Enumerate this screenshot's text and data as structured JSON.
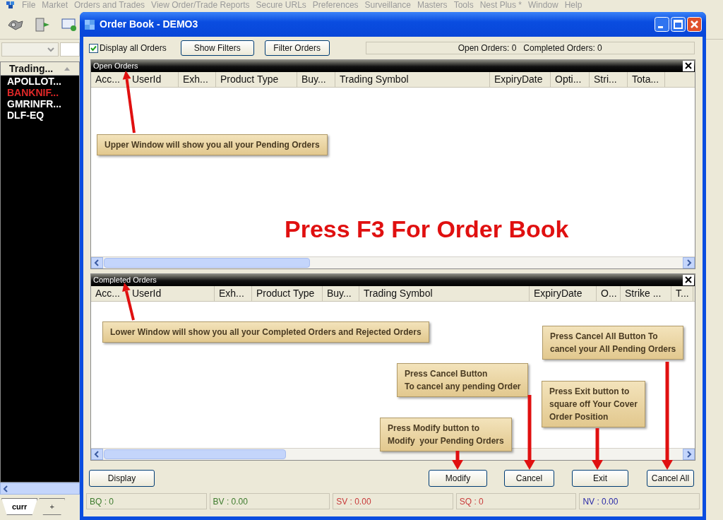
{
  "menu_bar": [
    "File",
    "Market",
    "Orders and Trades",
    "View Order/Trade Reports",
    "Secure URLs",
    "Preferences",
    "Surveillance",
    "Masters",
    "Tools",
    "Nest Plus *",
    "Window",
    "Help"
  ],
  "watch_list": {
    "header": "Trading...",
    "items": [
      {
        "symbol": "APOLLOT...",
        "color": "#ffffff"
      },
      {
        "symbol": "BANKNIF...",
        "color": "#e02828"
      },
      {
        "symbol": "GMRINFR...",
        "color": "#ffffff"
      },
      {
        "symbol": "DLF-EQ",
        "color": "#ffffff"
      }
    ]
  },
  "sheet_tabs": [
    {
      "label": "curr",
      "selected": true
    },
    {
      "label": "+",
      "selected": false
    }
  ],
  "window": {
    "title": "Order Book - DEMO3",
    "display_all_orders": {
      "label": "Display all Orders",
      "checked": true
    },
    "filter_buttons": [
      "Show Filters",
      "Filter Orders"
    ],
    "summary": "Open Orders: 0   Completed Orders: 0",
    "panels": [
      {
        "title": "Open Orders",
        "columns": [
          "Acc...",
          "UserId",
          "Exh...",
          "Product Type",
          "Buy...",
          "Trading Symbol",
          "ExpiryDate",
          "Opti...",
          "Stri...",
          "Tota..."
        ]
      },
      {
        "title": "Completed Orders",
        "columns": [
          "Acc...",
          "UserId",
          "Exh...",
          "Product Type",
          "Buy...",
          "Trading Symbol",
          "ExpiryDate",
          "O...",
          "Strike ...",
          "T..."
        ]
      }
    ],
    "action_buttons": [
      "Display",
      "Modify",
      "Cancel",
      "Exit",
      "Cancel All"
    ],
    "status_bar": [
      {
        "text": "BQ : 0",
        "color": "#3c7a2c"
      },
      {
        "text": "BV : 0.00",
        "color": "#3c7a2c"
      },
      {
        "text": "SV : 0.00",
        "color": "#c83a3a"
      },
      {
        "text": "SQ : 0",
        "color": "#c83a3a"
      },
      {
        "text": "NV : 0.00",
        "color": "#2a2aa8"
      }
    ]
  },
  "annotations": {
    "headline": "Press F3 For Order Book",
    "callouts": [
      {
        "lines": [
          "Upper Window will show you all your Pending Orders"
        ]
      },
      {
        "lines": [
          "Lower Window will show you all your Completed Orders and Rejected Orders"
        ]
      },
      {
        "lines": [
          "Press Cancel All Button To",
          "cancel your All Pending Orders"
        ]
      },
      {
        "lines": [
          "Press Cancel Button",
          "To cancel any pending Order"
        ]
      },
      {
        "lines": [
          "Press Exit button to",
          "square off Your Cover",
          "Order Position"
        ]
      },
      {
        "lines": [
          "Press Modify button to",
          "Modify  your Pending Orders"
        ]
      }
    ]
  }
}
